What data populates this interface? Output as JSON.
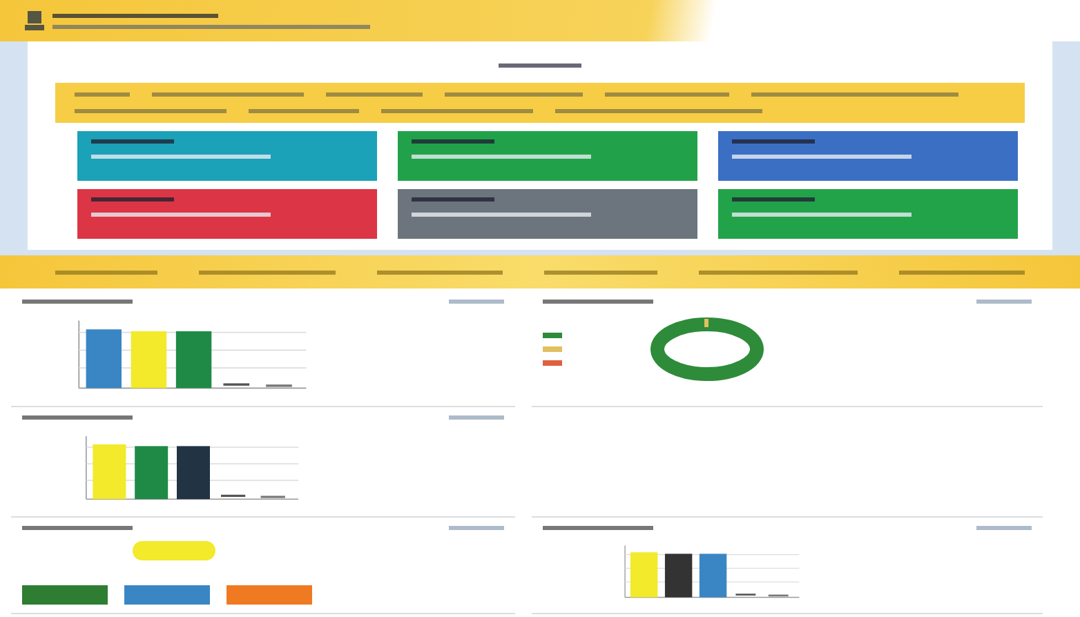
{
  "stat_cards": [
    {
      "color": "#1ba1b8"
    },
    {
      "color": "#21a24a"
    },
    {
      "color": "#3a6fc4"
    },
    {
      "color": "#dc3545"
    },
    {
      "color": "#6c757d"
    },
    {
      "color": "#22a34a"
    }
  ],
  "panels": [
    {
      "kind": "bars",
      "items": [
        {
          "color": "#3a86c4"
        },
        {
          "color": "#f2ea2a"
        },
        {
          "color": "#1f8a46"
        }
      ]
    },
    {
      "kind": "donut",
      "items": [
        {
          "color": "#2e8b3a"
        },
        {
          "color": "#e0c060"
        },
        {
          "color": "#e06040"
        }
      ]
    },
    {
      "kind": "bars",
      "items": [
        {
          "color": "#f2ea2a"
        },
        {
          "color": "#1f8a46"
        },
        {
          "color": "#223344"
        }
      ]
    },
    {
      "kind": "empty"
    },
    {
      "kind": "tiles",
      "items": [
        {
          "color": "#2e7d32"
        },
        {
          "color": "#3a86c4"
        },
        {
          "color": "#ef7a22"
        }
      ]
    },
    {
      "kind": "bars",
      "items": [
        {
          "color": "#f2ea2a"
        },
        {
          "color": "#333333"
        },
        {
          "color": "#3a86c4"
        }
      ]
    }
  ]
}
